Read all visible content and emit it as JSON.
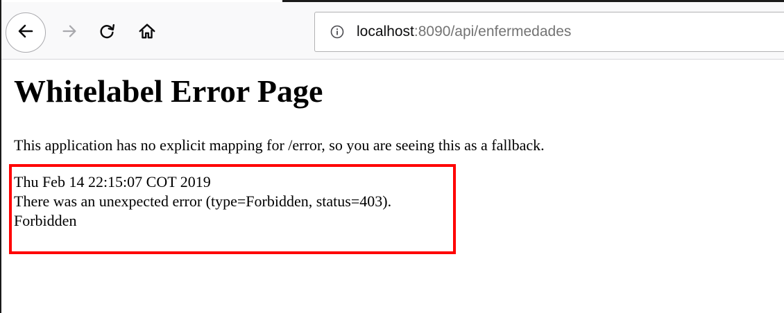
{
  "browser": {
    "url_host": "localhost",
    "url_rest": ":8090/api/enfermedades",
    "icons": {
      "back": "back-arrow-icon",
      "forward": "forward-arrow-icon",
      "reload": "reload-icon",
      "home": "home-icon",
      "site_info": "info-icon"
    }
  },
  "page": {
    "title": "Whitelabel Error Page",
    "description": "This application has no explicit mapping for /error, so you are seeing this as a fallback.",
    "error": {
      "timestamp": "Thu Feb 14 22:15:07 COT 2019",
      "message": "There was an unexpected error (type=Forbidden, status=403).",
      "detail": "Forbidden"
    }
  },
  "colors": {
    "highlight": "#ff0000",
    "toolbar": "#f9f9fa",
    "url_secondary": "#737373"
  }
}
